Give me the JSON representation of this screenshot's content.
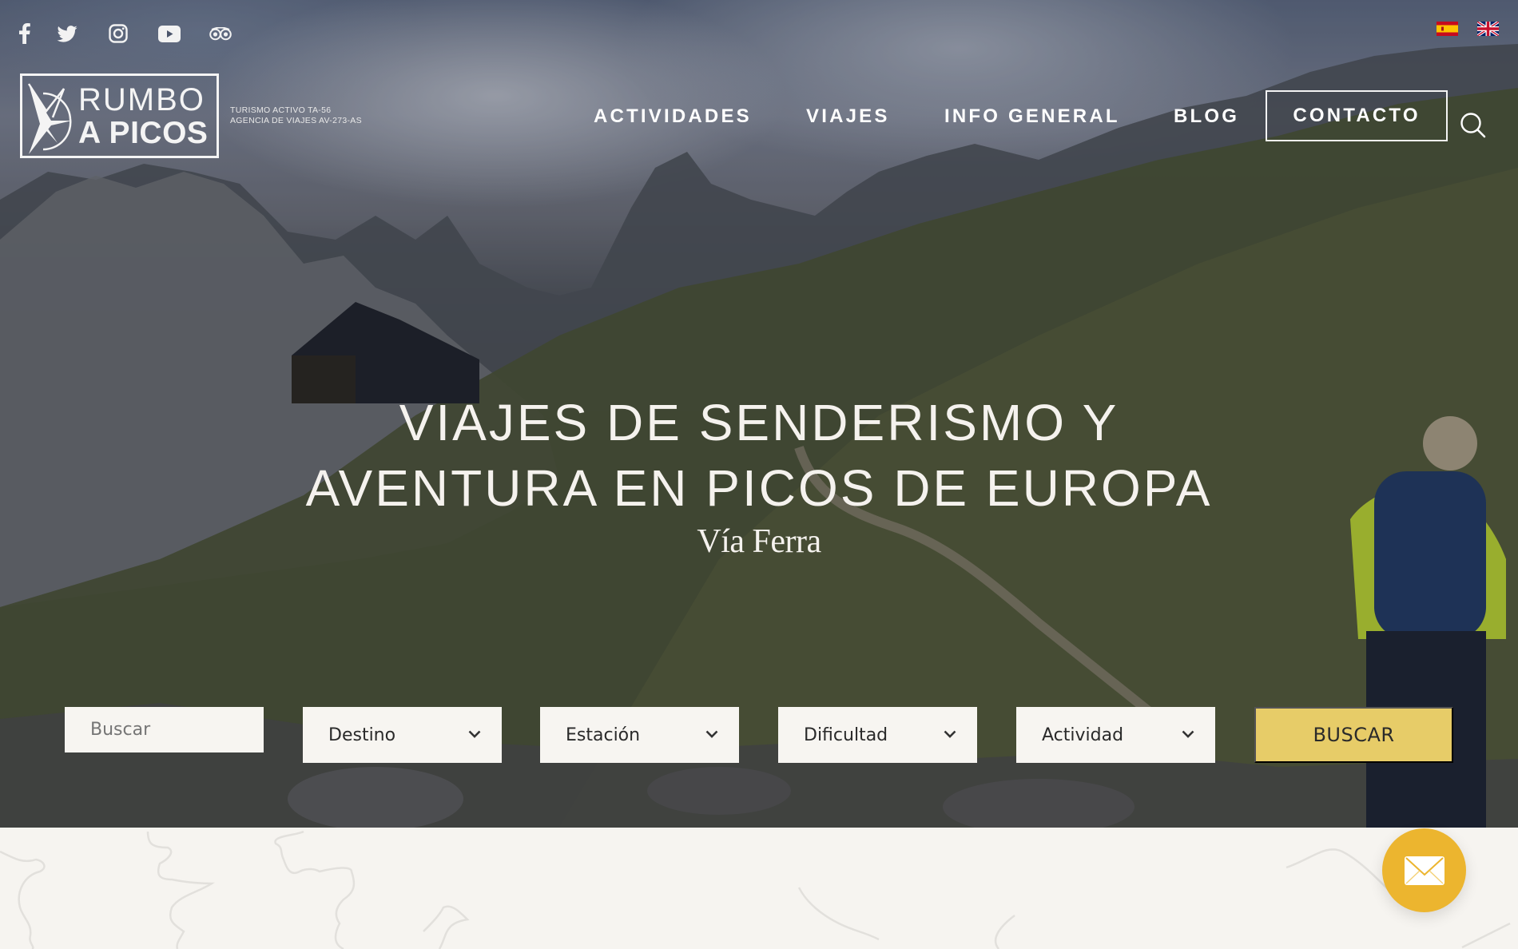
{
  "social": [
    {
      "name": "facebook",
      "icon": "facebook-icon"
    },
    {
      "name": "twitter",
      "icon": "twitter-icon"
    },
    {
      "name": "instagram",
      "icon": "instagram-icon"
    },
    {
      "name": "youtube",
      "icon": "youtube-icon"
    },
    {
      "name": "tripadvisor",
      "icon": "tripadvisor-icon"
    }
  ],
  "languages": [
    {
      "code": "es",
      "label": "Español",
      "icon": "spain-flag-icon"
    },
    {
      "code": "en",
      "label": "English",
      "icon": "uk-flag-icon"
    }
  ],
  "logo": {
    "line1": "RUMBO",
    "line2": "A PICOS"
  },
  "registration": {
    "line1": "TURISMO ACTIVO TA-56",
    "line2": "AGENCIA DE VIAJES AV-273-AS"
  },
  "nav": {
    "items": [
      "ACTIVIDADES",
      "VIAJES",
      "INFO GENERAL",
      "BLOG"
    ],
    "contact": "CONTACTO",
    "search_icon": "search-icon"
  },
  "hero": {
    "title_line1": "VIAJES DE SENDERISMO Y",
    "title_line2": "AVENTURA EN PICOS DE EUROPA",
    "photo_caption": "Vía Ferra"
  },
  "search": {
    "placeholder": "Buscar",
    "selects": [
      "Destino",
      "Estación",
      "Dificultad",
      "Actividad"
    ],
    "button": "BUSCAR"
  },
  "colors": {
    "accent_yellow": "#e7cc68",
    "mail_button": "#ecb52f",
    "page_bg": "#f6f4f0"
  },
  "floating": {
    "mail_icon": "envelope-icon"
  }
}
